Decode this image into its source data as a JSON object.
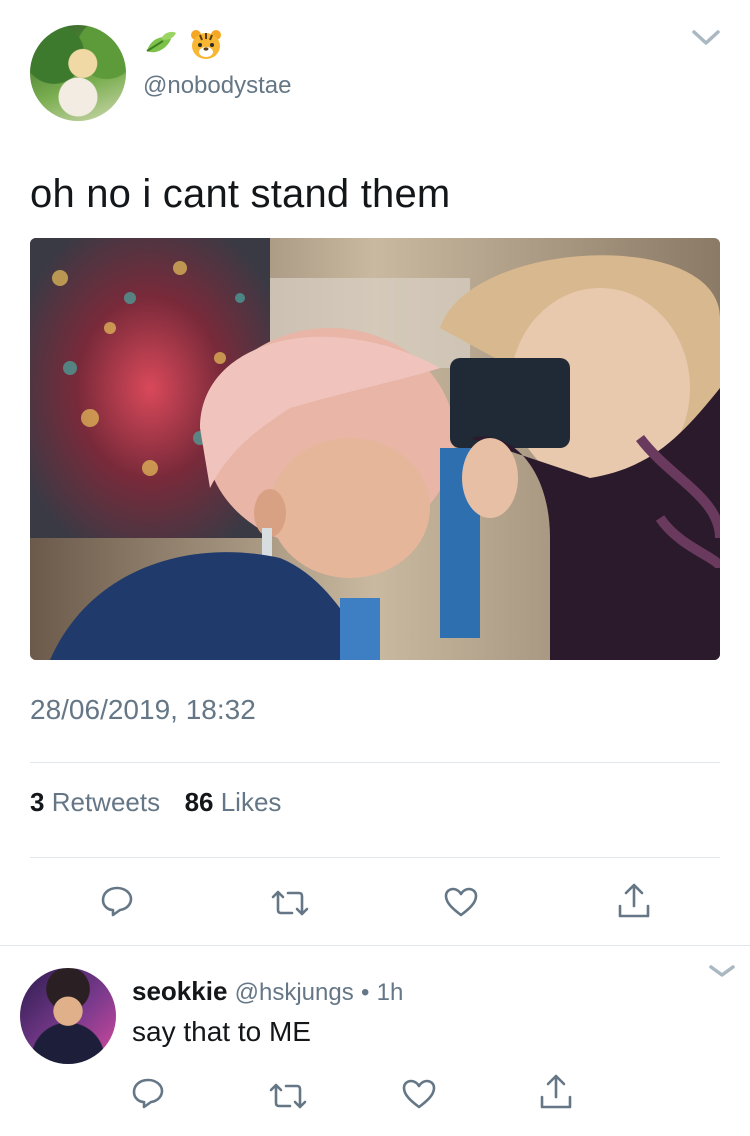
{
  "tweet": {
    "display_name_icons": [
      "leaf-icon",
      "tiger-face-icon"
    ],
    "username": "@nobodystae",
    "text": "oh no i cant stand them",
    "timestamp": "28/06/2019, 18:32",
    "retweets_count": "3",
    "retweets_label": "Retweets",
    "likes_count": "86",
    "likes_label": "Likes"
  },
  "actions": [
    "reply-icon",
    "retweet-icon",
    "like-icon",
    "share-icon"
  ],
  "reply": {
    "name": "seokkie",
    "handle": "@hskjungs",
    "separator": "•",
    "time": "1h",
    "text": "say that to ME"
  },
  "colors": {
    "secondary_text": "#657786",
    "divider": "#e1e8ed",
    "primary_text": "#14171a"
  }
}
